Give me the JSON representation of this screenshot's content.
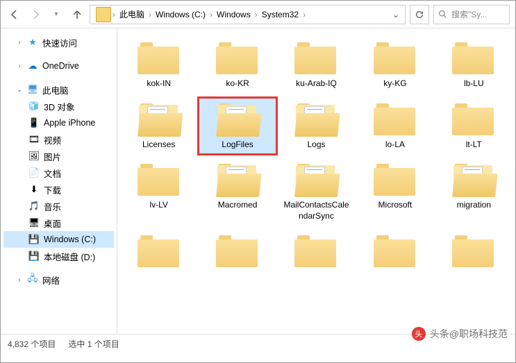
{
  "breadcrumbs": [
    "此电脑",
    "Windows (C:)",
    "Windows",
    "System32"
  ],
  "search": {
    "placeholder": "搜索\"Sy..."
  },
  "sidebar": {
    "quick": "快速访问",
    "onedrive": "OneDrive",
    "thispc": "此电脑",
    "children": [
      {
        "icon": "cube",
        "label": "3D 对象"
      },
      {
        "icon": "phone",
        "label": "Apple iPhone"
      },
      {
        "icon": "video",
        "label": "视频"
      },
      {
        "icon": "pic",
        "label": "图片"
      },
      {
        "icon": "doc",
        "label": "文档"
      },
      {
        "icon": "dl",
        "label": "下载"
      },
      {
        "icon": "music",
        "label": "音乐"
      },
      {
        "icon": "desk",
        "label": "桌面"
      },
      {
        "icon": "drive",
        "label": "Windows (C:)",
        "sel": true
      },
      {
        "icon": "drive",
        "label": "本地磁盘 (D:)"
      }
    ],
    "network": "网络"
  },
  "items": [
    {
      "label": "kok-IN"
    },
    {
      "label": "ko-KR"
    },
    {
      "label": "ku-Arab-IQ"
    },
    {
      "label": "ky-KG"
    },
    {
      "label": "lb-LU"
    },
    {
      "label": "Licenses",
      "open": true
    },
    {
      "label": "LogFiles",
      "open": true,
      "sel": true,
      "hilite": true
    },
    {
      "label": "Logs",
      "open": true
    },
    {
      "label": "lo-LA"
    },
    {
      "label": "lt-LT"
    },
    {
      "label": "lv-LV"
    },
    {
      "label": "Macromed",
      "open": true
    },
    {
      "label": "MailContactsCalendarSync",
      "open": true
    },
    {
      "label": "Microsoft"
    },
    {
      "label": "migration",
      "open": true
    },
    {
      "label": ""
    },
    {
      "label": ""
    },
    {
      "label": ""
    },
    {
      "label": ""
    },
    {
      "label": ""
    }
  ],
  "status": {
    "count": "4,832 个项目",
    "sel": "选中 1 个项目"
  },
  "watermark": "头条@职场科技范"
}
